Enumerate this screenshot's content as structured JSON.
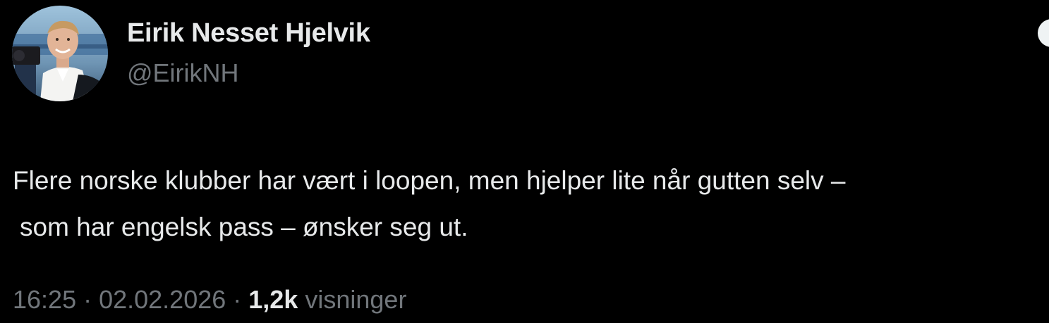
{
  "author": {
    "display_name": "Eirik Nesset Hjelvik",
    "handle": "@EirikNH",
    "avatar_icon": "profile-photo"
  },
  "tweet": {
    "text_line_1": "Flere norske klubber har vært i loopen, men hjelper lite når gutten selv –",
    "text_line_2": "som har engelsk pass – ønsker seg ut."
  },
  "meta": {
    "time": "16:25",
    "separator": " · ",
    "date": "02.02.2026",
    "views_count": "1,2k",
    "views_label": " visninger"
  },
  "colors": {
    "background": "#000000",
    "primary_text": "#e7e9ea",
    "secondary_text": "#71767b"
  }
}
